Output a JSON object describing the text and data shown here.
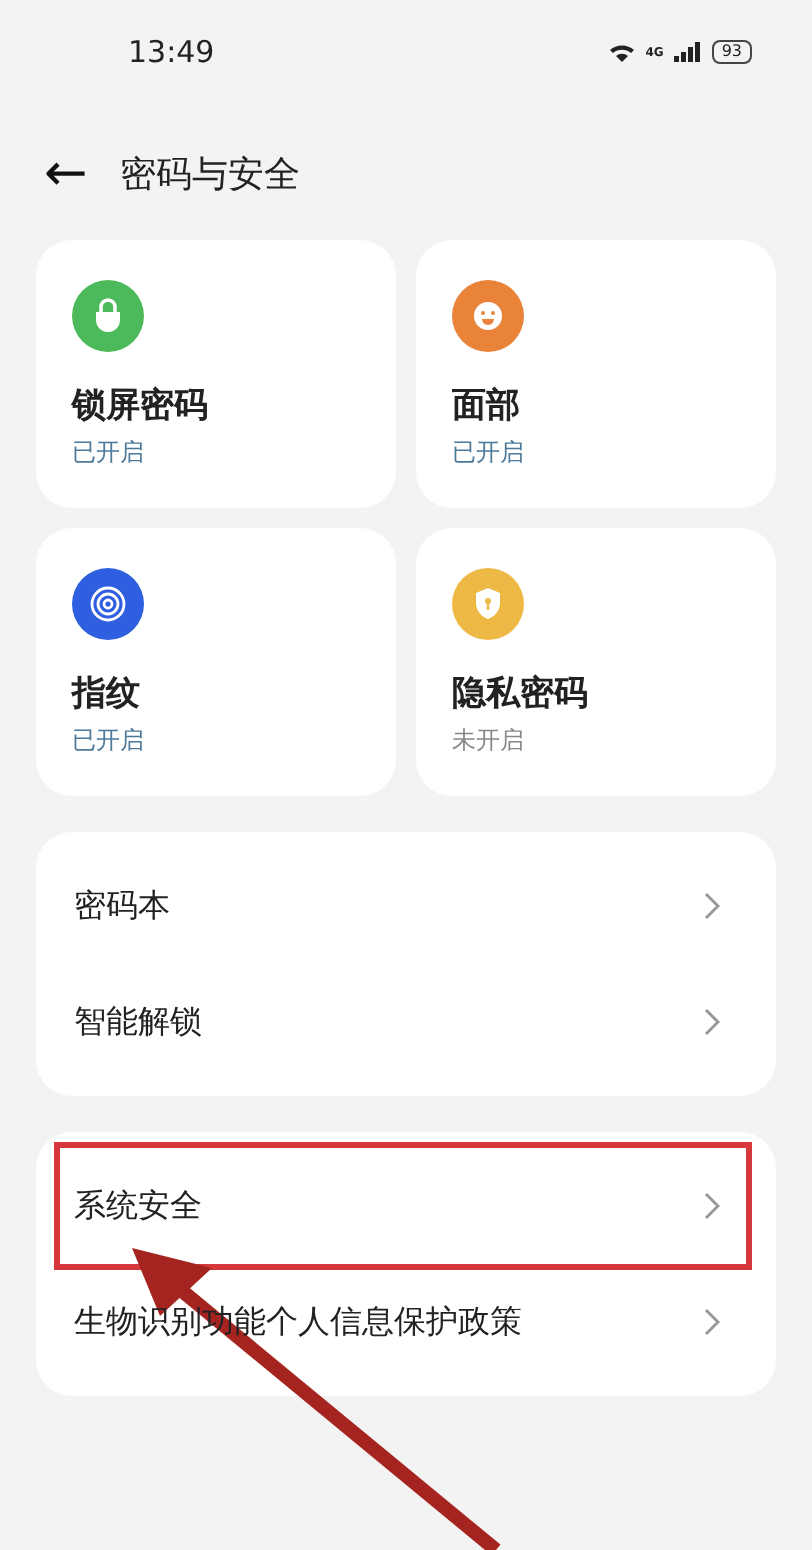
{
  "status_bar": {
    "time": "13:49",
    "network": "4G",
    "battery": "93"
  },
  "header": {
    "back": "←",
    "title": "密码与安全"
  },
  "cards": [
    {
      "kind": "lock",
      "color": "#4cb95a",
      "title": "锁屏密码",
      "status": "已开启",
      "on": true
    },
    {
      "kind": "face",
      "color": "#e9833a",
      "title": "面部",
      "status": "已开启",
      "on": true
    },
    {
      "kind": "fingerprint",
      "color": "#2f5fe0",
      "title": "指纹",
      "status": "已开启",
      "on": true
    },
    {
      "kind": "shield",
      "color": "#eeb844",
      "title": "隐私密码",
      "status": "未开启",
      "on": false
    }
  ],
  "groups": [
    {
      "items": [
        {
          "label": "密码本",
          "highlighted": false
        },
        {
          "label": "智能解锁",
          "highlighted": false
        }
      ]
    },
    {
      "items": [
        {
          "label": "系统安全",
          "highlighted": true
        },
        {
          "label": "生物识别功能个人信息保护政策",
          "highlighted": false
        }
      ]
    }
  ],
  "annotation_arrow": true
}
